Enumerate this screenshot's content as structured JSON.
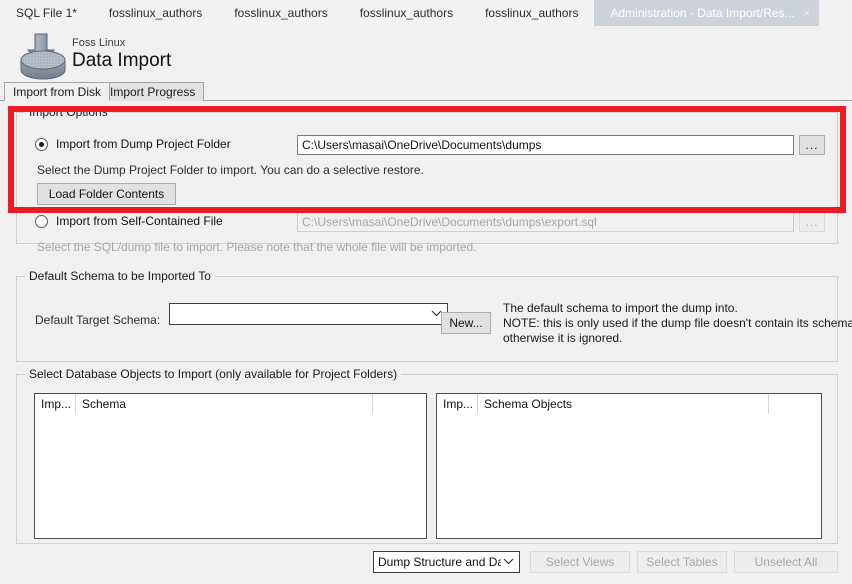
{
  "window": {
    "editor_tabs": [
      {
        "label": "SQL File 1*",
        "active": false,
        "closable": false
      },
      {
        "label": "fosslinux_authors",
        "active": false,
        "closable": false
      },
      {
        "label": "fosslinux_authors",
        "active": false,
        "closable": false
      },
      {
        "label": "fosslinux_authors",
        "active": false,
        "closable": false
      },
      {
        "label": "fosslinux_authors",
        "active": false,
        "closable": false
      },
      {
        "label": "Administration - Data Import/Res...",
        "active": true,
        "closable": true,
        "close_glyph": "×"
      }
    ]
  },
  "header": {
    "icon_name": "data-import-disk-icon",
    "supertitle": "Foss Linux",
    "title": "Data Import"
  },
  "inner_tabs": [
    {
      "label": "Import from Disk",
      "active": true
    },
    {
      "label": "Import Progress",
      "active": false
    }
  ],
  "import_options": {
    "group_title": "Import Options",
    "highlighted": true,
    "highlight_color": "#ee1b24",
    "dump_folder": {
      "radio_label": "Import from Dump Project Folder",
      "selected": true,
      "path_value": "C:\\Users\\masai\\OneDrive\\Documents\\dumps",
      "browse_label": "...",
      "hint": "Select the Dump Project Folder to import. You can do a selective restore.",
      "load_button_label": "Load Folder Contents"
    },
    "self_contained": {
      "radio_label": "Import from Self-Contained File",
      "selected": false,
      "path_value": "C:\\Users\\masai\\OneDrive\\Documents\\dumps\\export.sql",
      "path_disabled": true,
      "browse_label": "...",
      "browse_disabled": true,
      "hint": "Select the SQL/dump file to import. Please note that the whole file will be imported.",
      "hint_disabled": true
    }
  },
  "default_schema": {
    "group_title": "Default Schema to be Imported To",
    "field_label": "Default Target Schema:",
    "combo_value": "",
    "combo_arrow": "⌄",
    "new_button_label": "New...",
    "note": "The default schema to import the dump into.\nNOTE: this is only used if the dump file doesn't contain its schema,\notherwise it is ignored."
  },
  "database_objects": {
    "group_title": "Select Database Objects to Import (only available for Project Folders)",
    "left_list": {
      "columns": [
        "Imp...",
        "Schema"
      ],
      "rows": []
    },
    "right_list": {
      "columns": [
        "Imp...",
        "Schema Objects"
      ],
      "rows": []
    }
  },
  "footer": {
    "dump_type_combo": {
      "value": "Dump Structure and Dat",
      "arrow": "⌄"
    },
    "buttons": [
      {
        "label": "Select Views",
        "disabled": true
      },
      {
        "label": "Select Tables",
        "disabled": true
      },
      {
        "label": "Unselect All",
        "disabled": true
      }
    ]
  }
}
